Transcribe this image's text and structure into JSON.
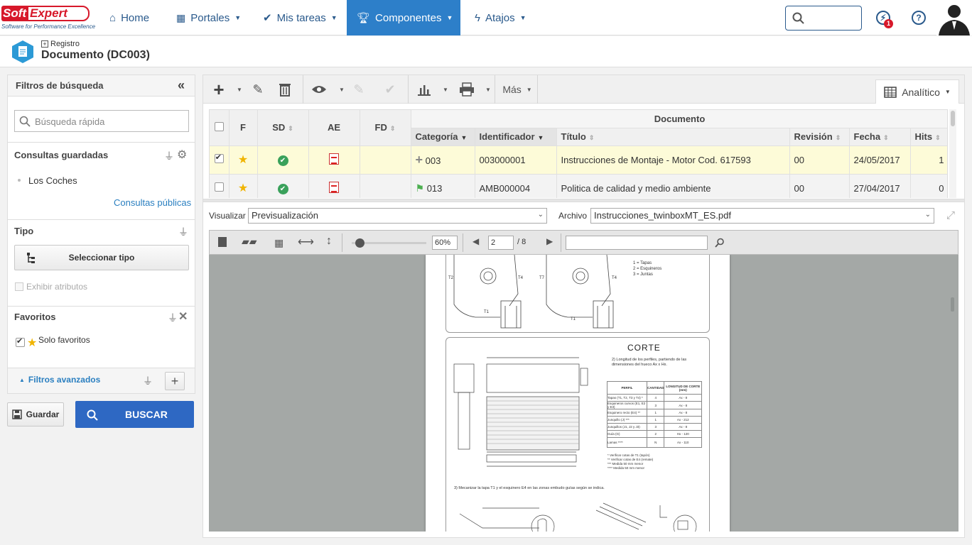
{
  "logo": {
    "brand_left": "Soft",
    "brand_right": "Expert",
    "tagline": "Software for Performance Excellence"
  },
  "nav": {
    "home": "Home",
    "portales": "Portales",
    "mis_tareas": "Mis tareas",
    "componentes": "Componentes",
    "atajos": "Atajos",
    "notification_count": "1"
  },
  "header": {
    "breadcrumb": "Registro",
    "title": "Documento (DC003)"
  },
  "filters": {
    "title": "Filtros de búsqueda",
    "quick_search_placeholder": "Búsqueda rápida",
    "saved_queries_title": "Consultas guardadas",
    "saved_query_item": "Los Coches",
    "public_queries_link": "Consultas públicas",
    "type_title": "Tipo",
    "select_type_button": "Seleccionar tipo",
    "show_attributes": "Exhibir atributos",
    "favorites_title": "Favoritos",
    "only_favorites": "Solo favoritos",
    "advanced_filters": "Filtros avanzados",
    "save_button": "Guardar",
    "search_button": "BUSCAR"
  },
  "toolbar": {
    "more": "Más",
    "view_mode": "Analítico"
  },
  "grid": {
    "group_header": "Documento",
    "columns": {
      "f": "F",
      "sd": "SD",
      "ae": "AE",
      "fd": "FD",
      "categoria": "Categoría",
      "identificador": "Identificador",
      "titulo": "Título",
      "revision": "Revisión",
      "fecha": "Fecha",
      "hits": "Hits"
    },
    "rows": [
      {
        "checked": true,
        "categoria": "003",
        "identificador": "003000001",
        "titulo": "Instrucciones de Montaje - Motor Cod. 617593",
        "revision": "00",
        "fecha": "24/05/2017",
        "hits": "1"
      },
      {
        "checked": false,
        "categoria": "013",
        "identificador": "AMB000004",
        "titulo": "Politica de calidad y medio ambiente",
        "revision": "00",
        "fecha": "27/04/2017",
        "hits": "0"
      }
    ]
  },
  "viewer": {
    "visualizar_label": "Visualizar",
    "visualizar_value": "Previsualización",
    "archivo_label": "Archivo",
    "archivo_value": "Instrucciones_twinboxMT_ES.pdf",
    "zoom": "60%",
    "page": "2",
    "total_pages": "/ 8",
    "search_value": ""
  },
  "document": {
    "legend_1": "1 = Tapas",
    "legend_2": "2 = Esquineros",
    "legend_3": "3 = Juntas",
    "section_title": "CORTE",
    "step_2": "2) Longitud de los perfiles, partiendo de las dimensiones del hueco Ax x Hx.",
    "table_headers": [
      "PERFIL",
      "CANTIDAD",
      "LONGITUD DE CORTE (mm)"
    ],
    "table_rows": [
      [
        "Tapas (T1, T2, T3 y T4) *",
        "4",
        "Ax - 8"
      ],
      [
        "Esquineros curvos (E1, E2 y E3)",
        "3",
        "Ax - 8"
      ],
      [
        "Esquinero recto (E4) **",
        "1",
        "Ax - 8"
      ],
      [
        "Junquillo (J) ***",
        "1",
        "Ax - 212"
      ],
      [
        "Junquillos (J1, J2 y J3)",
        "3",
        "Ax - 8"
      ],
      [
        "Guía (G)",
        "2",
        "Hx - 120"
      ],
      [
        "Lamas ****",
        "N",
        "Ax - 110"
      ]
    ],
    "notes": [
      "* Verificar cotas de T1 (tapón)",
      "** Verificar cotas de E4 (remate)",
      "*** Medida 50 mm menor",
      "**** Medida 50 mm menor"
    ],
    "step_3": "3) Mecanizar la tapa T1 y el esquinero E4 en las zonas embudo guías según se indica."
  }
}
